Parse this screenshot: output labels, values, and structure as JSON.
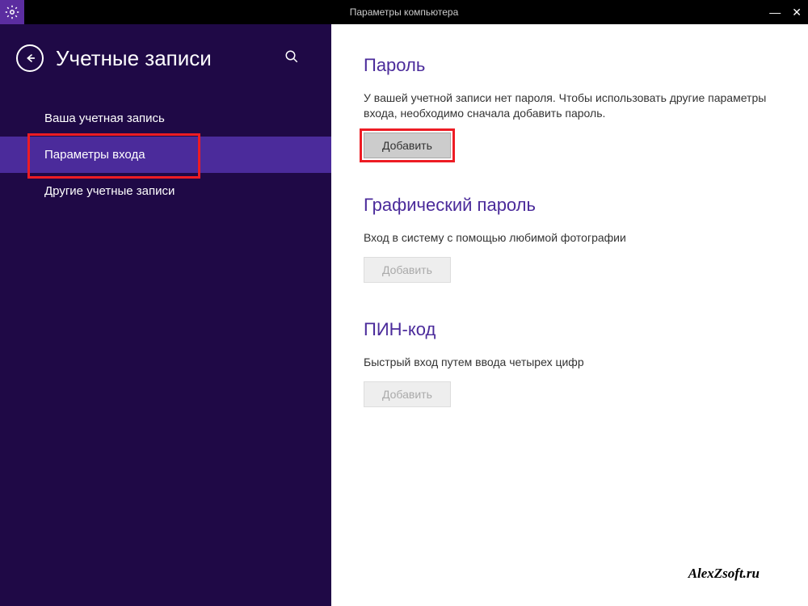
{
  "titlebar": {
    "title": "Параметры компьютера"
  },
  "sidebar": {
    "title": "Учетные записи",
    "items": [
      {
        "label": "Ваша учетная запись",
        "active": false
      },
      {
        "label": "Параметры входа",
        "active": true
      },
      {
        "label": "Другие учетные записи",
        "active": false
      }
    ]
  },
  "content": {
    "password": {
      "heading": "Пароль",
      "description": "У вашей учетной записи нет пароля. Чтобы использовать другие параметры входа, необходимо сначала добавить пароль.",
      "button": "Добавить"
    },
    "picture": {
      "heading": "Графический пароль",
      "description": "Вход в систему с помощью любимой фотографии",
      "button": "Добавить"
    },
    "pin": {
      "heading": "ПИН-код",
      "description": "Быстрый вход путем ввода четырех цифр",
      "button": "Добавить"
    }
  },
  "watermark": "AlexZsoft.ru"
}
